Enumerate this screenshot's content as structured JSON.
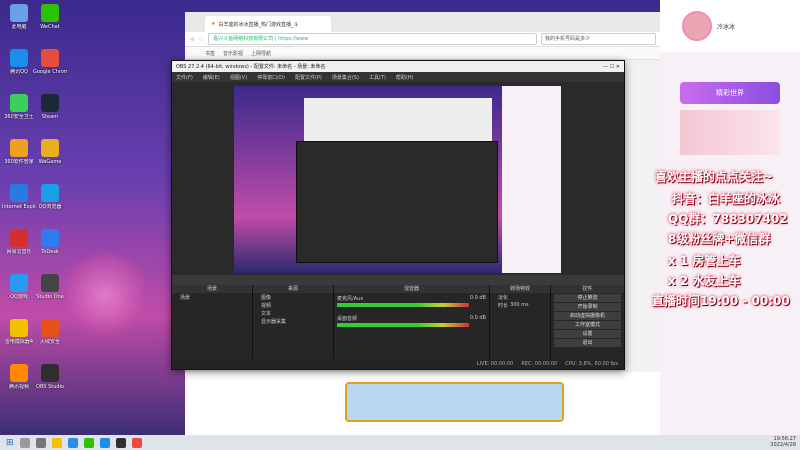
{
  "desktop": {
    "icons": [
      {
        "label": "此电脑",
        "icon": "computer-icon",
        "color": "#6aa0e8"
      },
      {
        "label": "WeChat",
        "icon": "wechat-icon",
        "color": "#2dc100"
      },
      {
        "label": "腾讯QQ",
        "icon": "qq-icon",
        "color": "#1a8ee8"
      },
      {
        "label": "Google Chrome",
        "icon": "chrome-icon",
        "color": "#e84c3d"
      },
      {
        "label": "360安全卫士",
        "icon": "shield-icon",
        "color": "#3ad05a"
      },
      {
        "label": "Steam",
        "icon": "steam-icon",
        "color": "#1b2838"
      },
      {
        "label": "360软件管家",
        "icon": "box-icon",
        "color": "#f0a020"
      },
      {
        "label": "WeGame",
        "icon": "game-icon",
        "color": "#e8b020"
      },
      {
        "label": "Internet Explorer",
        "icon": "ie-icon",
        "color": "#2a7be0"
      },
      {
        "label": "QQ浏览器",
        "icon": "browser-icon",
        "color": "#1a9ee8"
      },
      {
        "label": "网易云音乐",
        "icon": "music-icon",
        "color": "#d32f2f"
      },
      {
        "label": "ToDesk",
        "icon": "remote-icon",
        "color": "#2f7bf0"
      },
      {
        "label": "QQ游戏",
        "icon": "qqgame-icon",
        "color": "#2a9af0"
      },
      {
        "label": "Studio One",
        "icon": "studio-icon",
        "color": "#444"
      },
      {
        "label": "雷电模拟器4",
        "icon": "emulator-icon",
        "color": "#f2c200"
      },
      {
        "label": "火绒安全",
        "icon": "fire-icon",
        "color": "#e8501a"
      },
      {
        "label": "腾讯视频",
        "icon": "video-icon",
        "color": "#ff8a00"
      },
      {
        "label": "OBS Studio",
        "icon": "obs-icon",
        "color": "#302e31"
      }
    ]
  },
  "browser": {
    "tab_title": "白羊座的冰冰直播_热门游戏直播_斗",
    "url": "嘉兴斗鱼网络科技有限公司 | https://www",
    "search_text": "我的手机号码是多少",
    "bookmarks": [
      "书签",
      "音乐影视",
      "上网导航"
    ]
  },
  "obs": {
    "title": "OBS 27.2.4 (64-bit, windows) - 配置文件: 未命名 - 场景: 未命名",
    "menu": [
      "文件(F)",
      "编辑(E)",
      "视图(V)",
      "停靠窗口(D)",
      "配置文件(P)",
      "场景集合(S)",
      "工具(T)",
      "帮助(H)"
    ],
    "dock_headers": [
      "场景",
      "来源",
      "混音器",
      "转场特效",
      "控件"
    ],
    "scenes": [
      "场景"
    ],
    "sources": [
      "图像",
      "视频",
      "文本",
      "显示器采集"
    ],
    "mixer": [
      {
        "name": "麦克风/Aux",
        "db": "0.0 dB"
      },
      {
        "name": "桌面音频",
        "db": "0.0 dB"
      }
    ],
    "transition": {
      "type": "淡化",
      "duration_label": "时长",
      "duration": "300 ms"
    },
    "controls": [
      "停止推流",
      "开始录制",
      "启动虚拟摄像机",
      "工作室模式",
      "设置",
      "退出"
    ],
    "status": [
      "LIVE: 00:00:00",
      "REC: 00:00:00",
      "CPU: 3.8%, 60.00 fps"
    ]
  },
  "stream_panel": {
    "streamer": "冷冰冰",
    "banner": "精彩世界",
    "overlay_lines": [
      "喜欢主播的点点关注~",
      "抖音：白羊座的冰冰",
      "QQ群：788307402",
      "8级粉丝牌+微信群",
      "x 1 房管上车",
      "x 2 水友上车",
      "直播时间19:00 - 00:00"
    ]
  },
  "taskbar": {
    "time": "19:56:27",
    "date": "2022/4/28"
  }
}
